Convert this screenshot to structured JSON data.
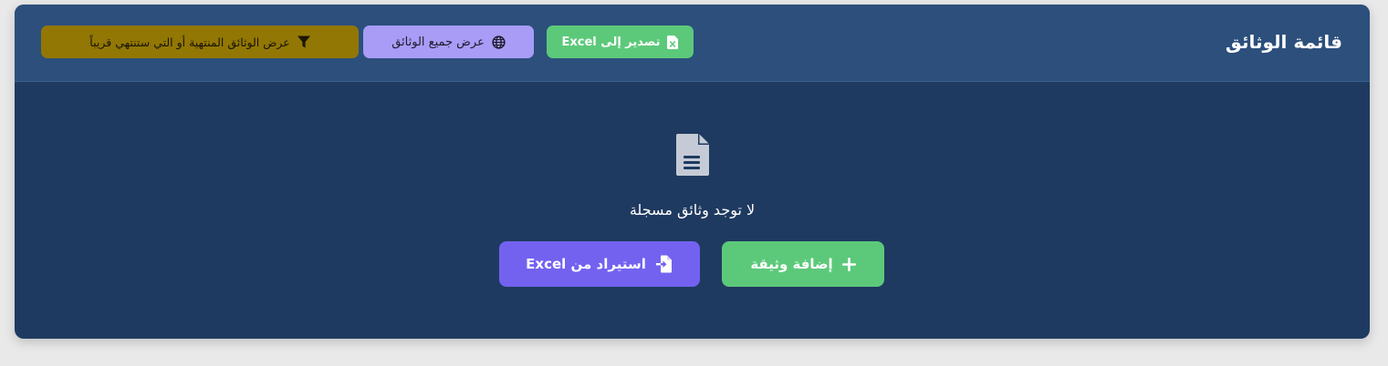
{
  "header": {
    "title": "قائمة الوثائق",
    "export_label": "تصدير إلى Excel",
    "show_all_label": "عرض جميع الوثائق",
    "filter_label": "عرض الوثائق المنتهية أو التي ستنتهي قريباً"
  },
  "empty_state": {
    "message": "لا توجد وثائق مسجلة",
    "add_label": "إضافة وثيقة",
    "import_label": "استيراد من Excel"
  },
  "icons": {
    "export": "excel-file-icon",
    "show_all": "globe-icon",
    "filter": "filter-icon",
    "empty": "document-icon",
    "add": "plus-icon",
    "import": "file-import-icon"
  },
  "colors": {
    "page_bg": "#e9e9ea",
    "header_bg": "#2c4f7c",
    "body_bg": "#1f3a60",
    "green": "#5cc97a",
    "lavender": "#a89cf6",
    "olive": "#927704",
    "purple": "#7362f0"
  }
}
